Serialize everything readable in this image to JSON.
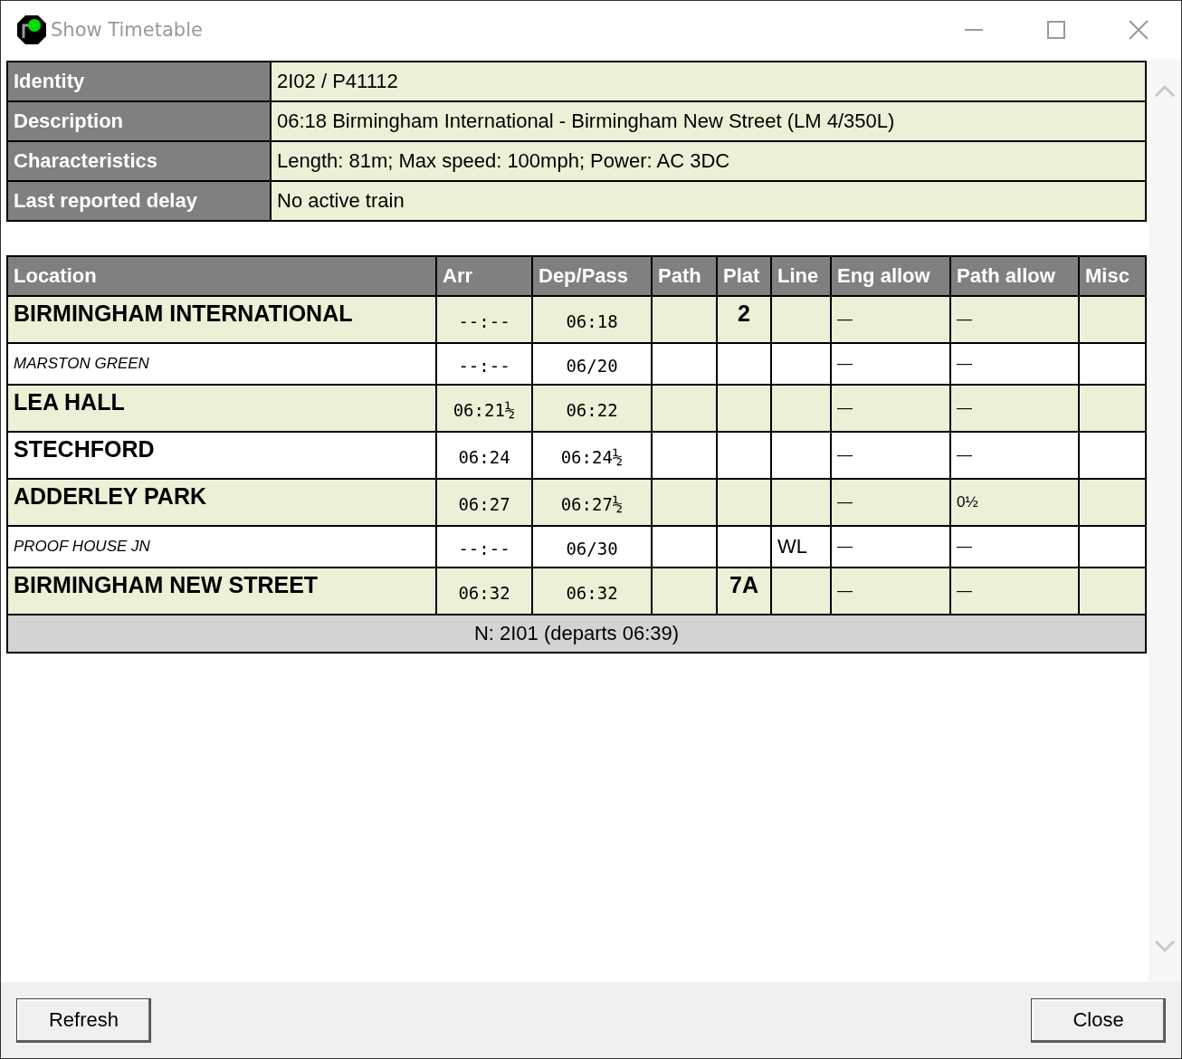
{
  "window": {
    "title": "Show Timetable"
  },
  "details": [
    {
      "label": "Identity",
      "value": "2I02 / P41112"
    },
    {
      "label": "Description",
      "value": "06:18 Birmingham International - Birmingham New Street (LM 4/350L)"
    },
    {
      "label": "Characteristics",
      "value": "Length: 81m; Max speed: 100mph; Power: AC 3DC"
    },
    {
      "label": "Last reported delay",
      "value": "No active train"
    }
  ],
  "timetable": {
    "columns": [
      "Location",
      "Arr",
      "Dep/Pass",
      "Path",
      "Plat",
      "Line",
      "Eng allow",
      "Path allow",
      "Misc"
    ],
    "rows": [
      {
        "kind": "stop",
        "location": "BIRMINGHAM INTERNATIONAL",
        "arr": "--:--",
        "dep": "06:18",
        "path": "",
        "plat": "2",
        "line": "",
        "eng_allow": "—",
        "path_allow": "—",
        "misc": ""
      },
      {
        "kind": "pass",
        "location": "MARSTON GREEN",
        "arr": "--:--",
        "dep": "06/20",
        "path": "",
        "plat": "",
        "line": "",
        "eng_allow": "—",
        "path_allow": "—",
        "misc": ""
      },
      {
        "kind": "stop",
        "location": "LEA HALL",
        "arr": "06:21½",
        "dep": "06:22",
        "path": "",
        "plat": "",
        "line": "",
        "eng_allow": "—",
        "path_allow": "—",
        "misc": ""
      },
      {
        "kind": "stop",
        "location": "STECHFORD",
        "arr": "06:24",
        "dep": "06:24½",
        "path": "",
        "plat": "",
        "line": "",
        "eng_allow": "—",
        "path_allow": "—",
        "misc": ""
      },
      {
        "kind": "stop",
        "location": "ADDERLEY PARK",
        "arr": "06:27",
        "dep": "06:27½",
        "path": "",
        "plat": "",
        "line": "",
        "eng_allow": "—",
        "path_allow": "0½",
        "misc": ""
      },
      {
        "kind": "pass",
        "location": "PROOF HOUSE JN",
        "arr": "--:--",
        "dep": "06/30",
        "path": "",
        "plat": "",
        "line": "WL",
        "eng_allow": "—",
        "path_allow": "—",
        "misc": ""
      },
      {
        "kind": "stop",
        "location": "BIRMINGHAM NEW STREET",
        "arr": "06:32",
        "dep": "06:32",
        "path": "",
        "plat": "7A",
        "line": "",
        "eng_allow": "—",
        "path_allow": "—",
        "misc": ""
      }
    ],
    "footer": "N: 2I01 (departs 06:39)"
  },
  "buttons": [
    "Refresh",
    "Close"
  ]
}
